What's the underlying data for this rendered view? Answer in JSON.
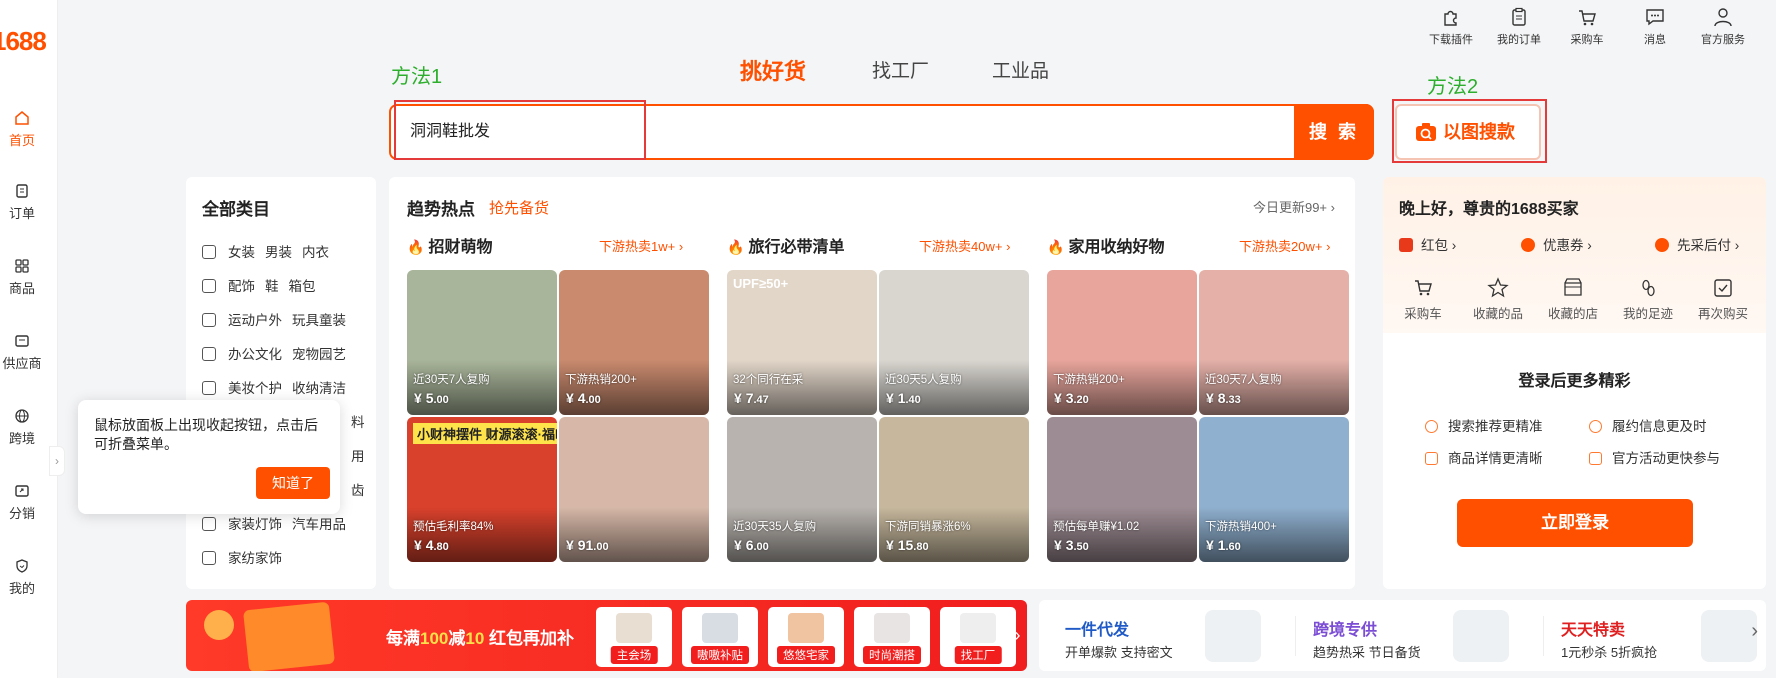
{
  "brand": {
    "logo_text": "1688"
  },
  "left_nav": [
    {
      "label": "首页",
      "icon": "home-icon",
      "active": true
    },
    {
      "label": "订单",
      "icon": "order-icon"
    },
    {
      "label": "商品",
      "icon": "grid-icon"
    },
    {
      "label": "供应商",
      "icon": "supplier-icon"
    },
    {
      "label": "跨境",
      "icon": "globe-icon"
    },
    {
      "label": "分销",
      "icon": "share-icon"
    },
    {
      "label": "我的",
      "icon": "user-shield-icon"
    }
  ],
  "topbar": [
    {
      "label": "下载插件",
      "icon": "puzzle-icon"
    },
    {
      "label": "我的订单",
      "icon": "clipboard-icon"
    },
    {
      "label": "采购车",
      "icon": "cart-icon"
    },
    {
      "label": "消息",
      "icon": "message-icon"
    },
    {
      "label": "官方服务",
      "icon": "person-icon"
    }
  ],
  "annotations": {
    "method1": "方法1",
    "method2": "方法2"
  },
  "search": {
    "tabs": [
      "挑好货",
      "找工厂",
      "工业品"
    ],
    "query": "洞洞鞋批发",
    "button": "搜 索",
    "image_search": "以图搜款"
  },
  "categories": {
    "title": "全部类目",
    "rows": [
      [
        "女装",
        "男装",
        "内衣"
      ],
      [
        "配饰",
        "鞋",
        "箱包"
      ],
      [
        "运动户外",
        "玩具童装"
      ],
      [
        "办公文化",
        "宠物园艺"
      ],
      [
        "美妆个护",
        "收纳清洁"
      ],
      [
        "家装灯饰",
        "汽车用品"
      ],
      [
        "家纺家饰"
      ]
    ],
    "hidden_fragments": [
      "料",
      "用",
      "齿"
    ]
  },
  "trends": {
    "title": "趋势热点",
    "subtitle": "抢先备货",
    "update": "今日更新99+",
    "columns": [
      {
        "title": "招财萌物",
        "more": "下游热卖1w+",
        "items": [
          {
            "label": "近30天7人复购",
            "price_int": "5",
            "price_dec": ".00",
            "bg": "#a9b59a"
          },
          {
            "label": "下游热销200+",
            "price_int": "4",
            "price_dec": ".00",
            "bg": "#c98a6e"
          },
          {
            "label": "预估毛利率84%",
            "price_int": "4",
            "price_dec": ".80",
            "bg": "#d9412c",
            "banner": "小财神摆件 财源滚滚·福临满门"
          },
          {
            "label": "",
            "price_int": "91",
            "price_dec": ".00",
            "bg": "#d7b8a8"
          }
        ]
      },
      {
        "title": "旅行必带清单",
        "more": "下游热卖40w+",
        "items": [
          {
            "label": "32个同行在采",
            "price_int": "7",
            "price_dec": ".47",
            "bg": "#e2d6c8",
            "banner": "UPF≥50+"
          },
          {
            "label": "近30天5人复购",
            "price_int": "1",
            "price_dec": ".40",
            "bg": "#d9d6d0"
          },
          {
            "label": "近30天35人复购",
            "price_int": "6",
            "price_dec": ".00",
            "bg": "#b8b3ae"
          },
          {
            "label": "下游同销暴涨6%",
            "price_int": "15",
            "price_dec": ".80",
            "bg": "#c7b89d"
          }
        ]
      },
      {
        "title": "家用收纳好物",
        "more": "下游热卖20w+",
        "items": [
          {
            "label": "下游热销200+",
            "price_int": "3",
            "price_dec": ".20",
            "bg": "#e8a59c"
          },
          {
            "label": "近30天7人复购",
            "price_int": "8",
            "price_dec": ".33",
            "bg": "#e4b0a8"
          },
          {
            "label": "预估每单赚¥1.02",
            "price_int": "3",
            "price_dec": ".50",
            "bg": "#9d8c93"
          },
          {
            "label": "下游热销400+",
            "price_int": "1",
            "price_dec": ".60",
            "bg": "#8fb0cf"
          }
        ]
      }
    ]
  },
  "user": {
    "greeting": "晚上好，尊贵的1688买家",
    "perks": [
      "红包",
      "优惠券",
      "先采后付"
    ],
    "quick": [
      {
        "label": "采购车",
        "icon": "cart-icon"
      },
      {
        "label": "收藏的品",
        "icon": "star-icon"
      },
      {
        "label": "收藏的店",
        "icon": "store-icon"
      },
      {
        "label": "我的足迹",
        "icon": "footprint-icon"
      },
      {
        "label": "再次购买",
        "icon": "check-box-icon"
      }
    ],
    "login_more": "登录后更多精彩",
    "features": [
      "搜索推荐更精准",
      "履约信息更及时",
      "商品详情更清晰",
      "官方活动更快参与"
    ],
    "login_button": "立即登录"
  },
  "tooltip": {
    "text": "鼠标放面板上出现收起按钮，点击后可折叠菜单。",
    "button": "知道了"
  },
  "promo": {
    "text_a": "每满",
    "text_b": "100",
    "text_c": "减",
    "text_d": "10",
    "text_e": "红包再加补",
    "cards": [
      "主会场",
      "嗷嗷补贴",
      "悠悠宅家",
      "时尚潮搭",
      "找工厂"
    ]
  },
  "services": [
    {
      "title": "一件代发",
      "sub": "开单爆款 支持密文",
      "color": "#1f5ac7"
    },
    {
      "title": "跨境专供",
      "sub": "趋势热采 节日备货",
      "color": "#7b4cd4"
    },
    {
      "title": "天天特卖",
      "sub": "1元秒杀 5折疯抢",
      "color": "#e02020"
    }
  ],
  "colors": {
    "accent": "#ff5000",
    "annotation_green": "#2dae2d",
    "annotation_red": "#e53a3a"
  }
}
